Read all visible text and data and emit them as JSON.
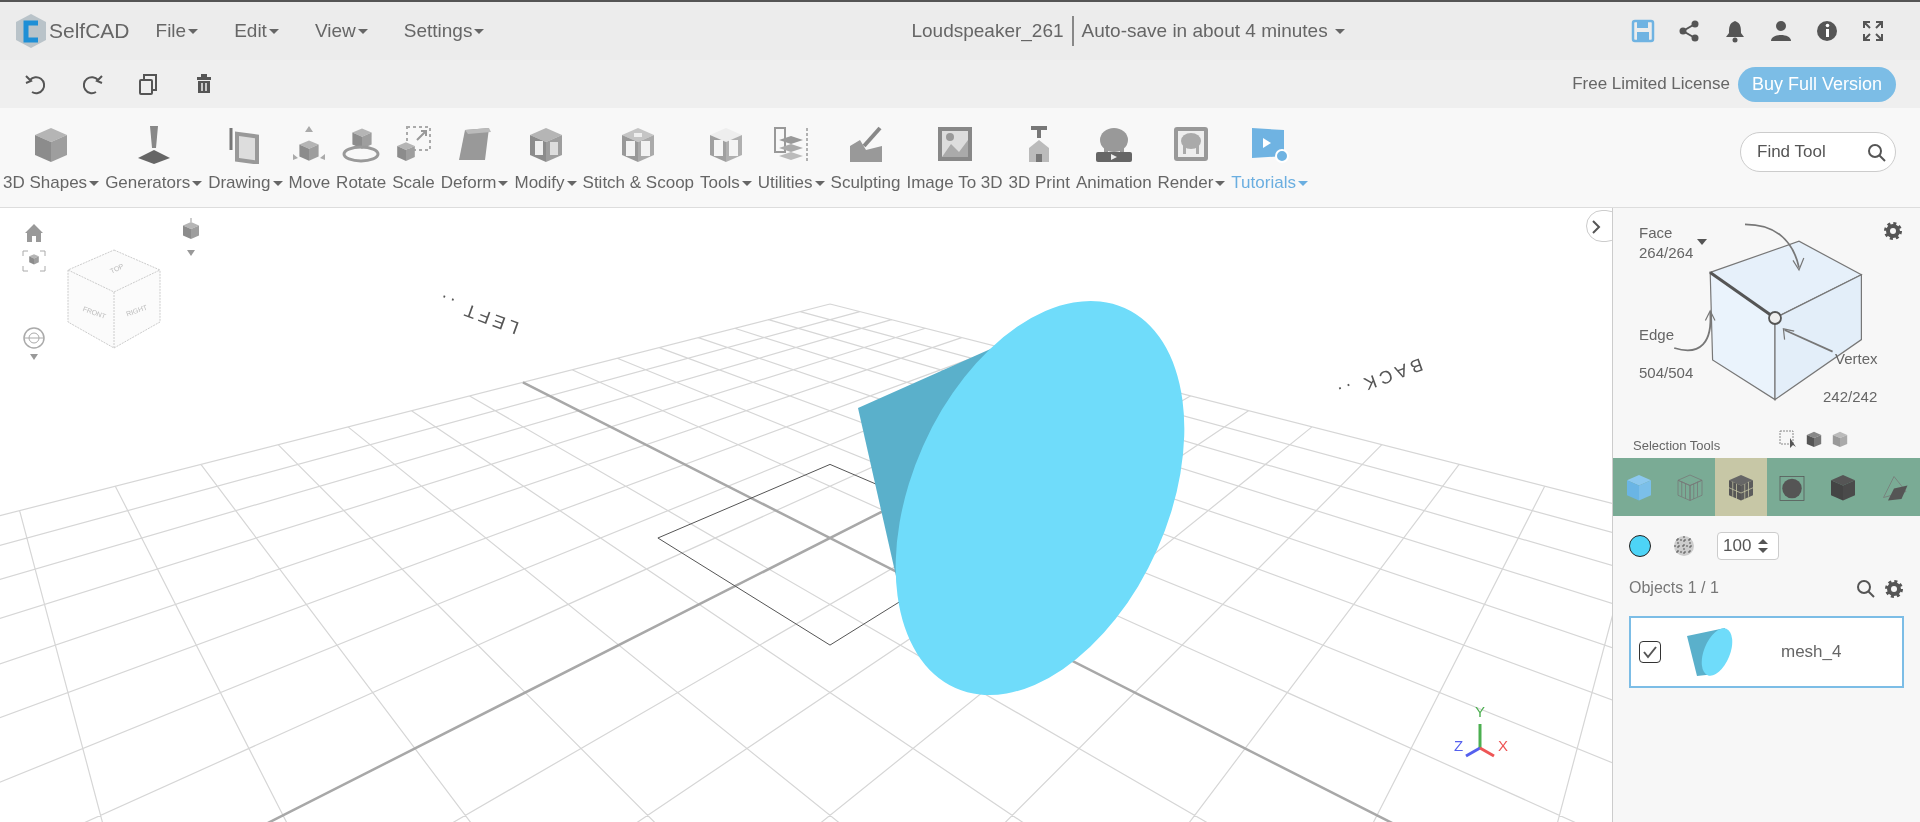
{
  "app": {
    "logo_text": "SelfCAD"
  },
  "menu": [
    {
      "label": "File"
    },
    {
      "label": "Edit"
    },
    {
      "label": "View"
    },
    {
      "label": "Settings"
    }
  ],
  "document": {
    "title": "Loudspeaker_261",
    "autosave": "Auto-save in about 4 minutes"
  },
  "license": {
    "text": "Free Limited License",
    "button": "Buy Full Version"
  },
  "tools": [
    {
      "label": "3D Shapes",
      "dropdown": true,
      "highlighted": false
    },
    {
      "label": "Generators",
      "dropdown": true,
      "highlighted": false
    },
    {
      "label": "Drawing",
      "dropdown": true,
      "highlighted": false
    },
    {
      "label": "Move",
      "dropdown": false,
      "highlighted": false
    },
    {
      "label": "Rotate",
      "dropdown": false,
      "highlighted": false
    },
    {
      "label": "Scale",
      "dropdown": false,
      "highlighted": false
    },
    {
      "label": "Deform",
      "dropdown": true,
      "highlighted": false
    },
    {
      "label": "Modify",
      "dropdown": true,
      "highlighted": false
    },
    {
      "label": "Stitch & Scoop",
      "dropdown": false,
      "highlighted": false
    },
    {
      "label": "Tools",
      "dropdown": true,
      "highlighted": false
    },
    {
      "label": "Utilities",
      "dropdown": true,
      "highlighted": false
    },
    {
      "label": "Sculpting",
      "dropdown": false,
      "highlighted": false
    },
    {
      "label": "Image To 3D",
      "dropdown": false,
      "highlighted": false
    },
    {
      "label": "3D Print",
      "dropdown": false,
      "highlighted": false
    },
    {
      "label": "Animation",
      "dropdown": false,
      "highlighted": false
    },
    {
      "label": "Render",
      "dropdown": true,
      "highlighted": false
    },
    {
      "label": "Tutorials",
      "dropdown": true,
      "highlighted": true
    }
  ],
  "find_tool": {
    "placeholder": "Find Tool"
  },
  "viewport": {
    "view_cube": {
      "faces": [
        "TOP",
        "FRONT",
        "RIGHT"
      ]
    },
    "grid_labels": [
      "LEFT ..",
      "BACK .."
    ],
    "axes": [
      "Y",
      "Z",
      "X"
    ]
  },
  "selection": {
    "modes": [
      {
        "label": "Face",
        "count": "264/264"
      },
      {
        "label": "Edge",
        "count": "504/504"
      },
      {
        "label": "Vertex",
        "count": "242/242"
      }
    ],
    "title": "Selection Tools",
    "tools": [
      {
        "selected": false
      },
      {
        "selected": false
      },
      {
        "selected": true
      },
      {
        "selected": false
      },
      {
        "selected": false
      },
      {
        "selected": false
      }
    ]
  },
  "material": {
    "color": "#4dd4f7",
    "opacity": "100"
  },
  "objects": {
    "title": "Objects 1 / 1",
    "items": [
      {
        "name": "mesh_4",
        "checked": true,
        "selected": true
      }
    ]
  }
}
